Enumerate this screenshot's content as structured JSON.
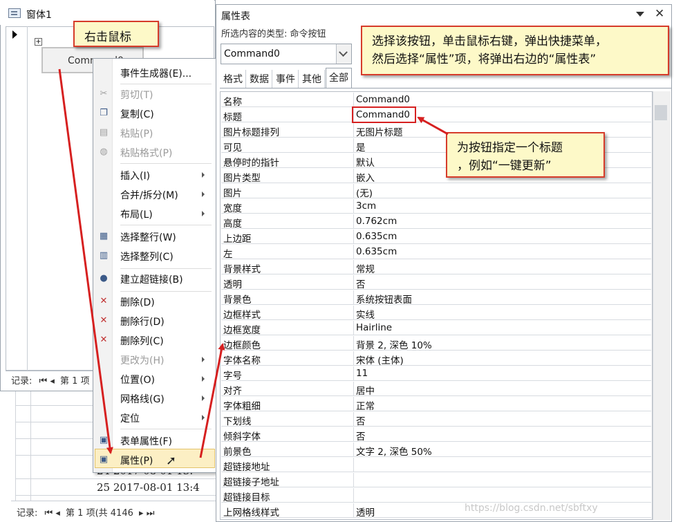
{
  "form_window": {
    "title": "窗体1",
    "command_button_label": "Command0",
    "nav_label": "记录:",
    "nav_position": "第 1 项",
    "nav_bottom_label": "记录:",
    "nav_bottom_position": "第 1 项(共 4146"
  },
  "datasheet": {
    "rows": [
      "24 2017-08-01  13:",
      "25 2017-08-01  13:4"
    ]
  },
  "context_menu": {
    "items": [
      {
        "label": "事件生成器(E)...",
        "disabled": false,
        "submenu": false,
        "icon": ""
      },
      {
        "label": "剪切(T)",
        "disabled": true,
        "submenu": false,
        "icon": "scissors-icon"
      },
      {
        "label": "复制(C)",
        "disabled": false,
        "submenu": false,
        "icon": "copy-icon"
      },
      {
        "label": "粘贴(P)",
        "disabled": true,
        "submenu": false,
        "icon": "paste-icon"
      },
      {
        "label": "粘贴格式(P)",
        "disabled": true,
        "submenu": false,
        "icon": "paste-format-icon"
      },
      {
        "label": "插入(I)",
        "disabled": false,
        "submenu": true,
        "icon": ""
      },
      {
        "label": "合并/拆分(M)",
        "disabled": false,
        "submenu": true,
        "icon": ""
      },
      {
        "label": "布局(L)",
        "disabled": false,
        "submenu": true,
        "icon": ""
      },
      {
        "label": "选择整行(W)",
        "disabled": false,
        "submenu": false,
        "icon": "select-row-icon"
      },
      {
        "label": "选择整列(C)",
        "disabled": false,
        "submenu": false,
        "icon": "select-column-icon"
      },
      {
        "label": "建立超链接(B)",
        "disabled": false,
        "submenu": false,
        "icon": "hyperlink-icon"
      },
      {
        "label": "删除(D)",
        "disabled": false,
        "submenu": false,
        "icon": "delete-icon"
      },
      {
        "label": "删除行(D)",
        "disabled": false,
        "submenu": false,
        "icon": "delete-row-icon"
      },
      {
        "label": "删除列(C)",
        "disabled": false,
        "submenu": false,
        "icon": "delete-column-icon"
      },
      {
        "label": "更改为(H)",
        "disabled": true,
        "submenu": true,
        "icon": ""
      },
      {
        "label": "位置(O)",
        "disabled": false,
        "submenu": true,
        "icon": ""
      },
      {
        "label": "网格线(G)",
        "disabled": false,
        "submenu": true,
        "icon": ""
      },
      {
        "label": "定位",
        "disabled": false,
        "submenu": true,
        "icon": ""
      },
      {
        "label": "表单属性(F)",
        "disabled": false,
        "submenu": false,
        "icon": "form-properties-icon"
      },
      {
        "label": "属性(P)",
        "disabled": false,
        "submenu": false,
        "icon": "properties-icon",
        "highlighted": true
      }
    ]
  },
  "property_sheet": {
    "title": "属性表",
    "selection_type_label": "所选内容的类型: 命令按钮",
    "selected_object": "Command0",
    "tabs": [
      "格式",
      "数据",
      "事件",
      "其他",
      "全部"
    ],
    "active_tab": "全部",
    "properties": [
      {
        "name": "名称",
        "value": "Command0"
      },
      {
        "name": "标题",
        "value": "Command0"
      },
      {
        "name": "图片标题排列",
        "value": "无图片标题"
      },
      {
        "name": "可见",
        "value": "是"
      },
      {
        "name": "悬停时的指针",
        "value": "默认"
      },
      {
        "name": "图片类型",
        "value": "嵌入"
      },
      {
        "name": "图片",
        "value": "(无)"
      },
      {
        "name": "宽度",
        "value": "3cm"
      },
      {
        "name": "高度",
        "value": "0.762cm"
      },
      {
        "name": "上边距",
        "value": "0.635cm"
      },
      {
        "name": "左",
        "value": "0.635cm"
      },
      {
        "name": "背景样式",
        "value": "常规"
      },
      {
        "name": "透明",
        "value": "否"
      },
      {
        "name": "背景色",
        "value": "系统按钮表面"
      },
      {
        "name": "边框样式",
        "value": "实线"
      },
      {
        "name": "边框宽度",
        "value": "Hairline"
      },
      {
        "name": "边框颜色",
        "value": "背景 2, 深色 10%"
      },
      {
        "name": "字体名称",
        "value": "宋体 (主体)"
      },
      {
        "name": "字号",
        "value": "11"
      },
      {
        "name": "对齐",
        "value": "居中"
      },
      {
        "name": "字体粗细",
        "value": "正常"
      },
      {
        "name": "下划线",
        "value": "否"
      },
      {
        "name": "倾斜字体",
        "value": "否"
      },
      {
        "name": "前景色",
        "value": "文字 2, 深色 50%"
      },
      {
        "name": "超链接地址",
        "value": ""
      },
      {
        "name": "超链接子地址",
        "value": ""
      },
      {
        "name": "超链接目标",
        "value": ""
      },
      {
        "name": "上网格线样式",
        "value": "透明"
      }
    ]
  },
  "annotations": {
    "right_click": "右击鼠标",
    "select_properties_line1": "选择该按钮，单击鼠标右键，弹出快捷菜单，",
    "select_properties_line2": "然后选择“属性”项，将弹出右边的“属性表”",
    "set_caption_line1": "为按钮指定一个标题",
    "set_caption_line2": "，例如“一键更新”"
  },
  "watermark": "https://blog.csdn.net/sbftxy",
  "colors": {
    "callout_border": "#d63b2a",
    "callout_fill": "#fdf9c8",
    "arrow": "#d62020",
    "menu_highlight": "#fcefc4"
  }
}
